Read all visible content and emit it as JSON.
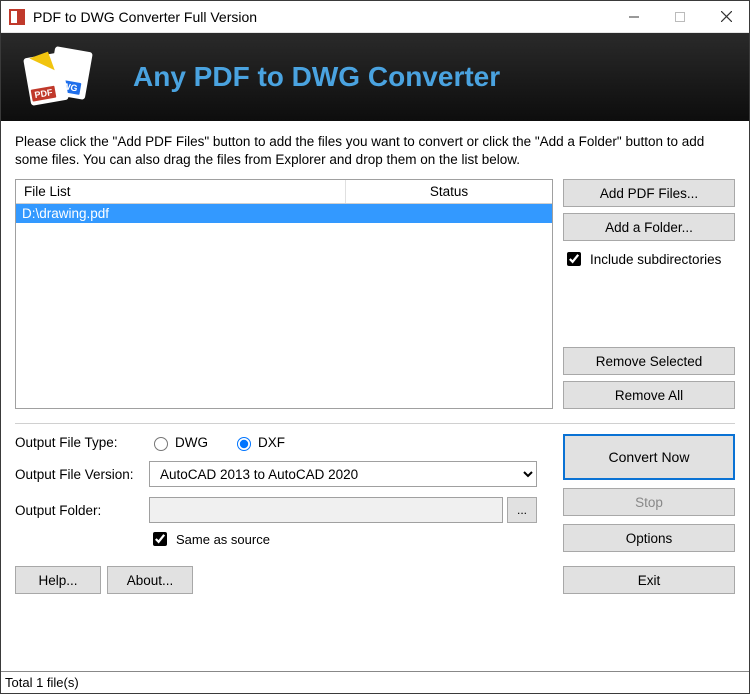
{
  "window": {
    "title": "PDF to DWG Converter Full Version"
  },
  "banner": {
    "title": "Any PDF to DWG Converter"
  },
  "instructions": "Please click the \"Add PDF Files\" button to add the files you want to convert or click the \"Add a Folder\" button to add some files. You can also drag the files from Explorer and drop them on the list below.",
  "list": {
    "headers": {
      "file": "File List",
      "status": "Status"
    },
    "rows": [
      {
        "file": "D:\\drawing.pdf",
        "status": "",
        "selected": true
      }
    ]
  },
  "side": {
    "add_files": "Add PDF Files...",
    "add_folder": "Add a Folder...",
    "include_subdirs_label": "Include subdirectories",
    "include_subdirs_checked": true,
    "remove_selected": "Remove Selected",
    "remove_all": "Remove All"
  },
  "output": {
    "type_label": "Output File Type:",
    "type_options": {
      "dwg": "DWG",
      "dxf": "DXF"
    },
    "type_selected": "dxf",
    "version_label": "Output File Version:",
    "version_selected": "AutoCAD 2013 to AutoCAD 2020",
    "folder_label": "Output Folder:",
    "folder_value": "",
    "browse_label": "...",
    "same_as_source_label": "Same as source",
    "same_as_source_checked": true
  },
  "actions": {
    "convert": "Convert Now",
    "stop": "Stop",
    "options": "Options"
  },
  "footer": {
    "help": "Help...",
    "about": "About...",
    "exit": "Exit"
  },
  "statusbar": "Total 1 file(s)"
}
